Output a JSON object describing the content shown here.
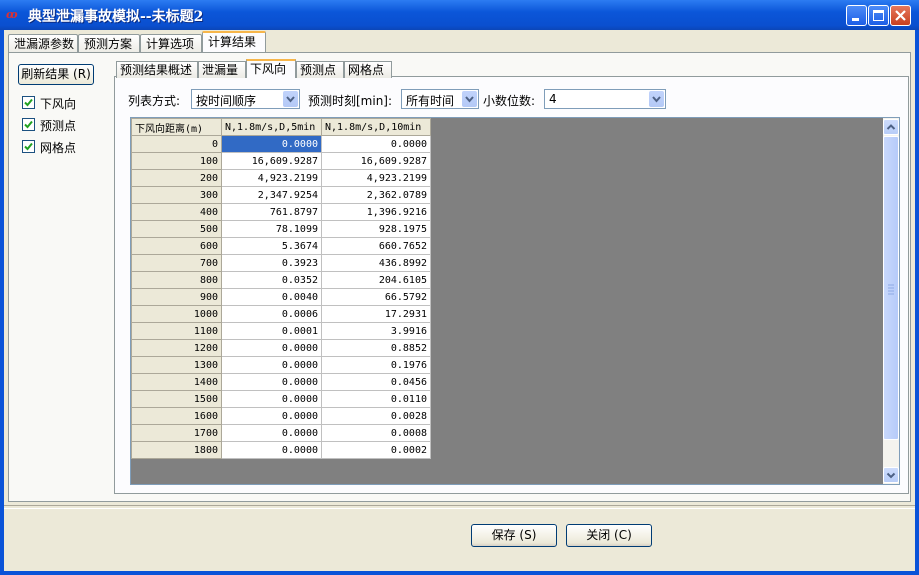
{
  "window": {
    "title": "典型泄漏事故模拟--未标题2",
    "app_icon": "app-logo-icon"
  },
  "main_tabs": [
    {
      "label": "泄漏源参数"
    },
    {
      "label": "预测方案"
    },
    {
      "label": "计算选项"
    },
    {
      "label": "计算结果"
    }
  ],
  "left_panel": {
    "refresh_label": "刷新结果 (R)",
    "checkboxes": [
      {
        "label": "下风向",
        "checked": true
      },
      {
        "label": "预测点",
        "checked": true
      },
      {
        "label": "网格点",
        "checked": true
      }
    ]
  },
  "result_tabs": [
    {
      "label": "预测结果概述"
    },
    {
      "label": "泄漏量"
    },
    {
      "label": "下风向"
    },
    {
      "label": "预测点"
    },
    {
      "label": "网格点"
    }
  ],
  "controls": {
    "list_mode_label": "列表方式:",
    "list_mode_value": "按时间顺序",
    "time_label": "预测时刻[min]:",
    "time_value": "所有时间",
    "decimals_label": "小数位数:",
    "decimals_value": "4"
  },
  "table": {
    "headers": [
      "下风向距离(m)",
      "N,1.8m/s,D,5min",
      "N,1.8m/s,D,10min"
    ],
    "rows": [
      [
        "0",
        "0.0000",
        "0.0000"
      ],
      [
        "100",
        "16,609.9287",
        "16,609.9287"
      ],
      [
        "200",
        "4,923.2199",
        "4,923.2199"
      ],
      [
        "300",
        "2,347.9254",
        "2,362.0789"
      ],
      [
        "400",
        "761.8797",
        "1,396.9216"
      ],
      [
        "500",
        "78.1099",
        "928.1975"
      ],
      [
        "600",
        "5.3674",
        "660.7652"
      ],
      [
        "700",
        "0.3923",
        "436.8992"
      ],
      [
        "800",
        "0.0352",
        "204.6105"
      ],
      [
        "900",
        "0.0040",
        "66.5792"
      ],
      [
        "1000",
        "0.0006",
        "17.2931"
      ],
      [
        "1100",
        "0.0001",
        "3.9916"
      ],
      [
        "1200",
        "0.0000",
        "0.8852"
      ],
      [
        "1300",
        "0.0000",
        "0.1976"
      ],
      [
        "1400",
        "0.0000",
        "0.0456"
      ],
      [
        "1500",
        "0.0000",
        "0.0110"
      ],
      [
        "1600",
        "0.0000",
        "0.0028"
      ],
      [
        "1700",
        "0.0000",
        "0.0008"
      ],
      [
        "1800",
        "0.0000",
        "0.0002"
      ]
    ]
  },
  "buttons": {
    "save_label": "保存 (S)",
    "close_label": "关闭 (C)"
  },
  "colors": {
    "titlebar": "#0b56d9",
    "selection": "#316ac5",
    "active_tab_accent": "#f7b64a"
  }
}
